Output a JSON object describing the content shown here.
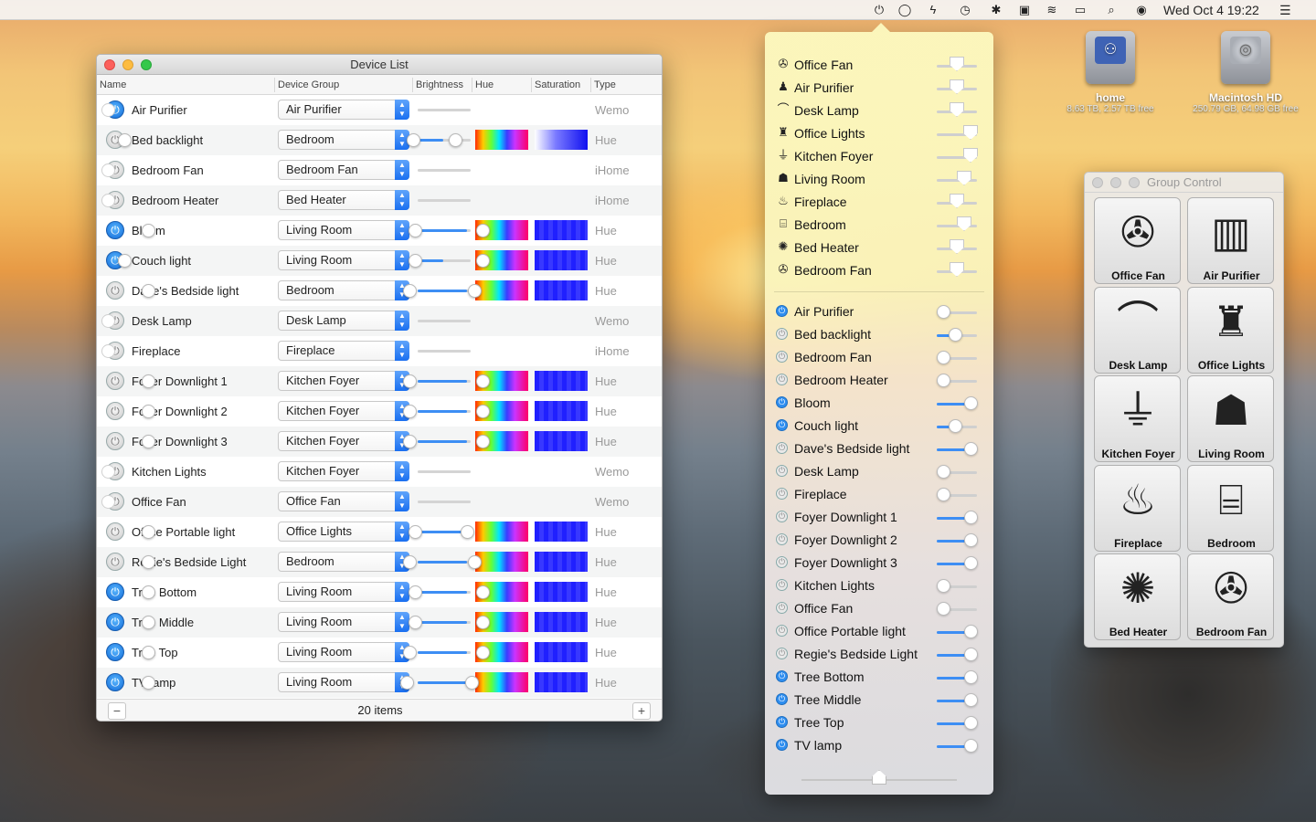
{
  "menubar": {
    "clock": "Wed Oct 4  19:22",
    "icons": [
      "power-menu-icon",
      "chat-icon",
      "bolt-icon",
      "time-machine-icon",
      "bluetooth-icon",
      "battery-icon",
      "wifi-icon",
      "airplay-icon",
      "search-icon",
      "siri-icon",
      "list-icon"
    ]
  },
  "desktop": {
    "home": {
      "name": "home",
      "info": "8.63 TB, 2.57 TB free"
    },
    "hd": {
      "name": "Macintosh HD",
      "info": "250.79 GB, 64.98 GB free"
    }
  },
  "device_list": {
    "title": "Device List",
    "columns": [
      "Name",
      "Device Group",
      "Brightness",
      "Hue",
      "Saturation",
      "Type"
    ],
    "footer": "20 items",
    "add_label": "+",
    "remove_label": "−",
    "rows": [
      {
        "name": "Air Purifier",
        "group": "Air Purifier",
        "type": "Wemo",
        "on": true
      },
      {
        "name": "Bed backlight",
        "group": "Bedroom",
        "type": "Hue",
        "on": false
      },
      {
        "name": "Bedroom Fan",
        "group": "Bedroom Fan",
        "type": "iHome",
        "on": false
      },
      {
        "name": "Bedroom Heater",
        "group": "Bed Heater",
        "type": "iHome",
        "on": false
      },
      {
        "name": "Bloom",
        "group": "Living Room",
        "type": "Hue",
        "on": true
      },
      {
        "name": "Couch light",
        "group": "Living Room",
        "type": "Hue",
        "on": true
      },
      {
        "name": "Dave's Bedside light",
        "group": "Bedroom",
        "type": "Hue",
        "on": false
      },
      {
        "name": "Desk Lamp",
        "group": "Desk Lamp",
        "type": "Wemo",
        "on": false
      },
      {
        "name": "Fireplace",
        "group": "Fireplace",
        "type": "iHome",
        "on": false
      },
      {
        "name": "Foyer Downlight 1",
        "group": "Kitchen Foyer",
        "type": "Hue",
        "on": false
      },
      {
        "name": "Foyer Downlight 2",
        "group": "Kitchen Foyer",
        "type": "Hue",
        "on": false
      },
      {
        "name": "Foyer Downlight 3",
        "group": "Kitchen Foyer",
        "type": "Hue",
        "on": false
      },
      {
        "name": "Kitchen Lights",
        "group": "Kitchen Foyer",
        "type": "Wemo",
        "on": false
      },
      {
        "name": "Office Fan",
        "group": "Office Fan",
        "type": "Wemo",
        "on": false
      },
      {
        "name": "Office Portable light",
        "group": "Office Lights",
        "type": "Hue",
        "on": false
      },
      {
        "name": "Regie's Bedside Light",
        "group": "Bedroom",
        "type": "Hue",
        "on": false
      },
      {
        "name": "Tree Bottom",
        "group": "Living Room",
        "type": "Hue",
        "on": true
      },
      {
        "name": "Tree Middle",
        "group": "Living Room",
        "type": "Hue",
        "on": true
      },
      {
        "name": "Tree Top",
        "group": "Living Room",
        "type": "Hue",
        "on": true
      },
      {
        "name": "TV lamp",
        "group": "Living Room",
        "type": "Hue",
        "on": true
      }
    ]
  },
  "popover": {
    "groups": [
      {
        "label": "Office Fan",
        "icon": "fan-icon"
      },
      {
        "label": "Air Purifier",
        "icon": "purifier-icon"
      },
      {
        "label": "Desk Lamp",
        "icon": "desk-lamp-icon"
      },
      {
        "label": "Office Lights",
        "icon": "office-icon"
      },
      {
        "label": "Kitchen Foyer",
        "icon": "pendant-lamp-icon"
      },
      {
        "label": "Living Room",
        "icon": "sofa-icon"
      },
      {
        "label": "Fireplace",
        "icon": "fire-icon"
      },
      {
        "label": "Bedroom",
        "icon": "bed-icon"
      },
      {
        "label": "Bed Heater",
        "icon": "heater-icon"
      },
      {
        "label": "Bedroom Fan",
        "icon": "fan-icon"
      }
    ],
    "devices": [
      {
        "label": "Air Purifier",
        "on": true
      },
      {
        "label": "Bed backlight",
        "on": false
      },
      {
        "label": "Bedroom Fan",
        "on": false
      },
      {
        "label": "Bedroom Heater",
        "on": false
      },
      {
        "label": "Bloom",
        "on": true
      },
      {
        "label": "Couch light",
        "on": true
      },
      {
        "label": "Dave's Bedside light",
        "on": false
      },
      {
        "label": "Desk Lamp",
        "on": false
      },
      {
        "label": "Fireplace",
        "on": false
      },
      {
        "label": "Foyer Downlight 1",
        "on": false
      },
      {
        "label": "Foyer Downlight 2",
        "on": false
      },
      {
        "label": "Foyer Downlight 3",
        "on": false
      },
      {
        "label": "Kitchen Lights",
        "on": false
      },
      {
        "label": "Office Fan",
        "on": false
      },
      {
        "label": "Office Portable light",
        "on": false
      },
      {
        "label": "Regie's Bedside Light",
        "on": false
      },
      {
        "label": "Tree Bottom",
        "on": true
      },
      {
        "label": "Tree Middle",
        "on": true
      },
      {
        "label": "Tree Top",
        "on": true
      },
      {
        "label": "TV lamp",
        "on": true
      }
    ]
  },
  "group_control": {
    "title": "Group Control",
    "tiles": [
      {
        "label": "Office Fan",
        "icon": "fan-icon",
        "glyph": "✇"
      },
      {
        "label": "Air Purifier",
        "icon": "purifier-icon",
        "glyph": "▥"
      },
      {
        "label": "Desk Lamp",
        "icon": "desk-lamp-icon",
        "glyph": "⌒"
      },
      {
        "label": "Office Lights",
        "icon": "office-worker-icon",
        "glyph": "♜"
      },
      {
        "label": "Kitchen Foyer",
        "icon": "pendant-lamp-icon",
        "glyph": "⏚"
      },
      {
        "label": "Living Room",
        "icon": "sofa-icon",
        "glyph": "☗"
      },
      {
        "label": "Fireplace",
        "icon": "fire-icon",
        "glyph": "♨"
      },
      {
        "label": "Bedroom",
        "icon": "bed-icon",
        "glyph": "⌸"
      },
      {
        "label": "Bed Heater",
        "icon": "heater-icon",
        "glyph": "✺"
      },
      {
        "label": "Bedroom Fan",
        "icon": "fan-icon",
        "glyph": "✇"
      }
    ]
  },
  "colors": {
    "accent": "#3d8ef4",
    "power_on": "#1a78e8"
  }
}
